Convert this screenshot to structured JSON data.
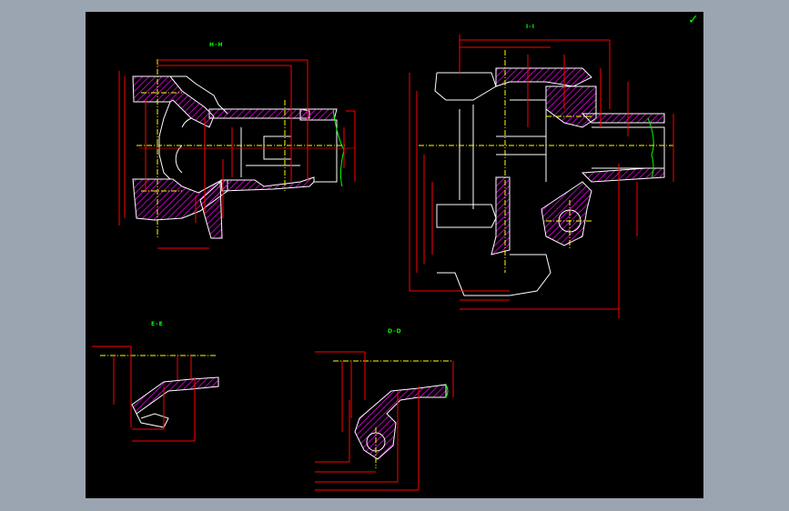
{
  "drawing": {
    "views": [
      {
        "id": "view1",
        "label": "H-H"
      },
      {
        "id": "view2",
        "label": "I-I"
      },
      {
        "id": "view3",
        "label": "E-E"
      },
      {
        "id": "view4",
        "label": "D-D"
      }
    ],
    "status_icon": "checkmark-icon",
    "colors": {
      "background": "#000000",
      "outline": "#ffffff",
      "dimension": "#ff0000",
      "hatch": "#ff00ff",
      "centerline": "#ffff00",
      "break_line": "#00ff00",
      "label": "#00ff00"
    }
  }
}
